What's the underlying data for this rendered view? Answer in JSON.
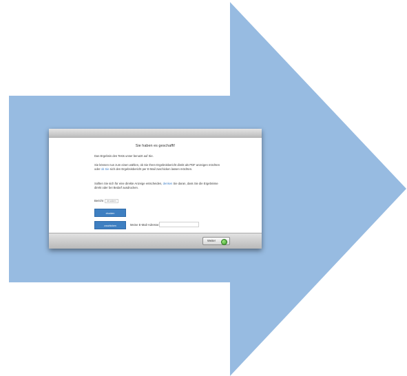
{
  "colors": {
    "arrow": "#97BBE1",
    "primary_button": "#3E7FC1",
    "link": "#3B7CC6"
  },
  "dialog": {
    "heading": "Sie haben es geschafft!",
    "paragraph1": "Das Ergebnis des Tests unser benutzt auf Sie.",
    "paragraph2_part1": "Sie können nun zum einen wählen, ob Sie Ihren Ergebnisbericht direkt als PDF anzeigen möchten oder ",
    "paragraph2_link": "ob Sie",
    "paragraph2_part2": " sich den Ergebnisbericht per E-Mail zuschicken lassen möchten.",
    "paragraph3_part1": "Sollten Sie sich für eine direkte Anzeige entscheiden, ",
    "paragraph3_link": "denken",
    "paragraph3_part2": " Sie daran, dass Sie die Ergebnisse direkt oder bei Bedarf ausdrucken.",
    "print_label": "Bericht",
    "print_hint": "drucken",
    "print_button": "drucken",
    "send_button": "zuschicken",
    "email_label": "Meine E-Mail-Adresse:",
    "email_value": "",
    "email_placeholder": ""
  },
  "footer": {
    "next_label": "Weiter",
    "next_icon": "go-green-circle-icon"
  }
}
